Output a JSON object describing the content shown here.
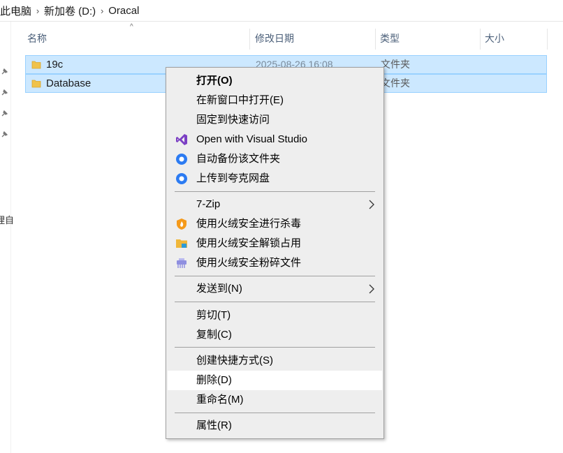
{
  "breadcrumb": {
    "items": [
      "此电脑",
      "新加卷 (D:)",
      "Oracal"
    ]
  },
  "nav_fragment": "理自",
  "columns": {
    "name": "名称",
    "modified": "修改日期",
    "type": "类型",
    "size": "大小"
  },
  "files": [
    {
      "name": "19c",
      "modified": "2025-08-26 16:08",
      "type": "文件夹"
    },
    {
      "name": "Database",
      "modified": "",
      "type": "文件夹"
    }
  ],
  "context_menu": {
    "open": "打开(O)",
    "open_new_window": "在新窗口中打开(E)",
    "pin_quick_access": "固定到快速访问",
    "open_visual_studio": "Open with Visual Studio",
    "auto_backup": "自动备份该文件夹",
    "upload_quark": "上传到夸克网盘",
    "seven_zip": "7-Zip",
    "huorong_scan": "使用火绒安全进行杀毒",
    "huorong_unlock": "使用火绒安全解锁占用",
    "huorong_shred": "使用火绒安全粉碎文件",
    "send_to": "发送到(N)",
    "cut": "剪切(T)",
    "copy": "复制(C)",
    "create_shortcut": "创建快捷方式(S)",
    "delete": "删除(D)",
    "rename": "重命名(M)",
    "properties": "属性(R)"
  },
  "colors": {
    "selection": "#cce8ff",
    "selection_border": "#99d1ff",
    "menu_bg": "#eeeeee",
    "folder": "#f0c24a"
  }
}
